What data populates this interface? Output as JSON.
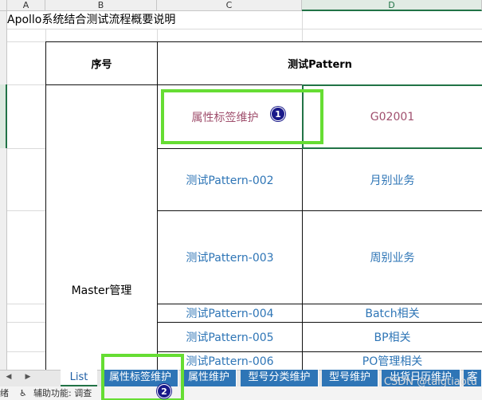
{
  "columns": [
    "A",
    "B",
    "C",
    "D"
  ],
  "title": "Apollo系统结合测试流程概要说明",
  "table": {
    "header_no": "序号",
    "header_pattern": "测试Pattern",
    "group_label": "Master管理",
    "rows": [
      {
        "pattern": "属性标签维护",
        "desc": "G02001"
      },
      {
        "pattern": "测试Pattern-002",
        "desc": "月别业务"
      },
      {
        "pattern": "测试Pattern-003",
        "desc": "周别业务"
      },
      {
        "pattern": "测试Pattern-004",
        "desc": "Batch相关"
      },
      {
        "pattern": "测试Pattern-005",
        "desc": "BP相关"
      },
      {
        "pattern": "测试Pattern-006",
        "desc": "PO管理相关"
      }
    ]
  },
  "badges": [
    "1",
    "2"
  ],
  "sheet_tabs": [
    "List",
    "属性标签维护",
    "属性维护",
    "型号分类维护",
    "型号维护",
    "出货日历维护",
    "客"
  ],
  "status": {
    "text": "辅助功能: 调查",
    "left_fragment": "绪"
  },
  "watermark": "CSDN @taigtiaotu",
  "colors": {
    "accent_green": "#217346",
    "highlight_green": "#66dd33",
    "tab_blue": "#2e75b6",
    "link_blue": "#2e75b6",
    "badge_navy": "#1a1a8a"
  }
}
